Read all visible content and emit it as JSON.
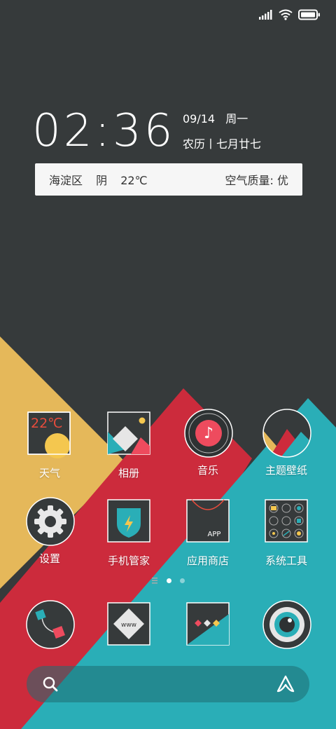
{
  "status_bar": {
    "signal_icon": "signal-icon",
    "wifi_icon": "wifi-icon",
    "battery_icon": "battery-icon"
  },
  "clock": {
    "time": "02:36",
    "date": "09/14",
    "weekday": "周一",
    "lunar": "农历丨七月廿七"
  },
  "weather": {
    "district": "海淀区",
    "condition": "阴",
    "temperature": "22℃",
    "air_quality": "空气质量: 优"
  },
  "apps": [
    {
      "label": "天气",
      "icon": "weather-icon",
      "icon_text": "22℃"
    },
    {
      "label": "相册",
      "icon": "gallery-icon"
    },
    {
      "label": "音乐",
      "icon": "music-icon"
    },
    {
      "label": "主题壁纸",
      "icon": "theme-wallpaper-icon"
    },
    {
      "label": "设置",
      "icon": "settings-gear-icon"
    },
    {
      "label": "手机管家",
      "icon": "security-shield-icon"
    },
    {
      "label": "应用商店",
      "icon": "app-store-icon",
      "icon_text": "APP"
    },
    {
      "label": "系统工具",
      "icon": "system-tools-icon"
    }
  ],
  "dock": [
    {
      "icon": "phone-icon"
    },
    {
      "icon": "browser-icon",
      "icon_text": "www"
    },
    {
      "icon": "messages-icon"
    },
    {
      "icon": "camera-icon"
    }
  ],
  "page_indicator": {
    "pages": 2,
    "current": 1
  },
  "search_bar": {
    "search_icon": "search-icon",
    "assistant_icon": "assistant-icon"
  },
  "colors": {
    "background": "#363a3b",
    "yellow": "#e5b85a",
    "red": "#cc2b3c",
    "teal": "#2aaeb7",
    "pink": "#ee4b5e"
  }
}
